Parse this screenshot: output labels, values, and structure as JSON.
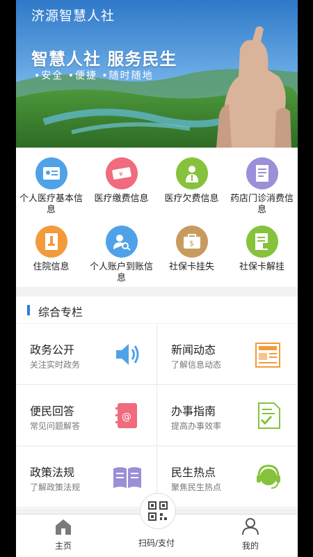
{
  "app": {
    "title": "济源智慧人社"
  },
  "banner": {
    "slogan": "智慧人社  服务民生",
    "slogan_sub": "•安全  •便捷  •随时随地"
  },
  "functions": [
    {
      "label": "个人医疗基本信息",
      "icon": "id-card-icon",
      "color": "#4fa2e8"
    },
    {
      "label": "医疗缴费信息",
      "icon": "ticket-icon",
      "color": "#f06b7d"
    },
    {
      "label": "医疗欠费信息",
      "icon": "doctor-icon",
      "color": "#86c23b"
    },
    {
      "label": "药店门诊消费信息",
      "icon": "receipt-icon",
      "color": "#9a8fd8"
    },
    {
      "label": "住院信息",
      "icon": "document-icon",
      "color": "#f39a3a"
    },
    {
      "label": "个人账户到账信息",
      "icon": "account-search-icon",
      "color": "#4fa2e8"
    },
    {
      "label": "社保卡挂失",
      "icon": "wallet-icon",
      "color": "#c79b5e"
    },
    {
      "label": "社保卡解挂",
      "icon": "unlock-document-icon",
      "color": "#86c23b"
    }
  ],
  "section": {
    "title": "综合专栏"
  },
  "cards": [
    {
      "title": "政务公开",
      "subtitle": "关注实时政务",
      "icon": "speaker-icon"
    },
    {
      "title": "新闻动态",
      "subtitle": "了解信息动态",
      "icon": "newspaper-icon"
    },
    {
      "title": "便民回答",
      "subtitle": "常见问题解答",
      "icon": "address-book-icon"
    },
    {
      "title": "办事指南",
      "subtitle": "提高办事效率",
      "icon": "checklist-icon"
    },
    {
      "title": "政策法规",
      "subtitle": "了解政策法规",
      "icon": "book-icon"
    },
    {
      "title": "民生热点",
      "subtitle": "聚焦民生热点",
      "icon": "customer-service-icon"
    }
  ],
  "nav": {
    "home": "主页",
    "scan": "扫码/支付",
    "me": "我的"
  }
}
